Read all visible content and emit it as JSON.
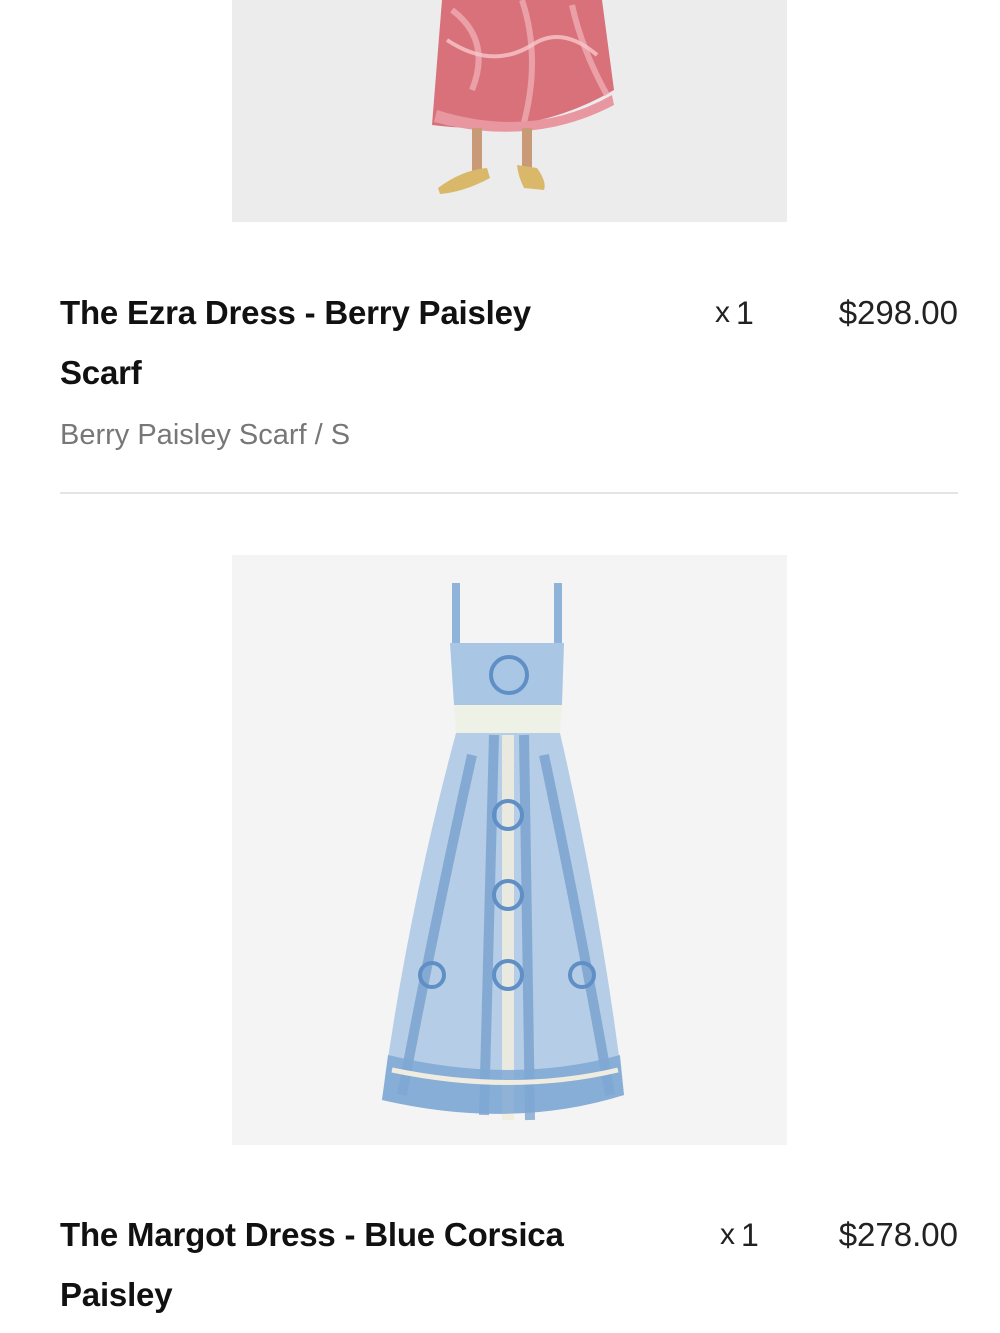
{
  "items": [
    {
      "title_line1": "The Ezra Dress - Berry Paisley",
      "title_line2": "Scarf",
      "variant": "Berry Paisley Scarf / S",
      "qty_prefix": "x",
      "qty": "1",
      "price": "$298.00",
      "image_icon": "pink-paisley-dress-photo"
    },
    {
      "title_line1": "The Margot Dress - Blue Corsica",
      "title_line2": "Paisley",
      "qty_prefix": "x",
      "qty": "1",
      "price": "$278.00",
      "image_icon": "blue-paisley-dress-photo"
    }
  ],
  "colors": {
    "title": "#111111",
    "variant": "#777777",
    "divider": "#e4e4e4",
    "image_bg": "#f3f3f3",
    "dress_pink": "#d9717a",
    "dress_blue": "#8fb3d9"
  }
}
